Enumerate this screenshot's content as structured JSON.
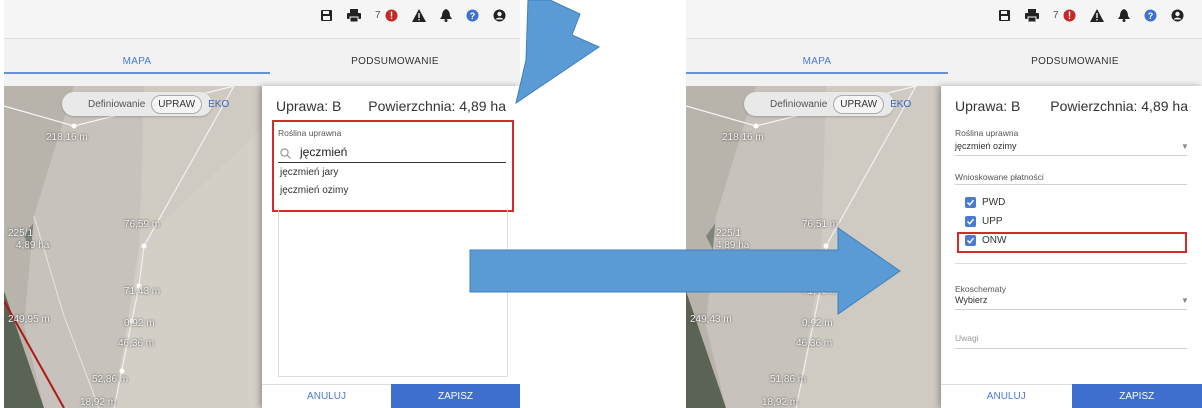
{
  "toolbar": {
    "notification_count": "7",
    "icons": [
      "save-icon",
      "print-icon",
      "error-badge-icon",
      "warning-icon",
      "bell-icon",
      "help-icon",
      "user-icon"
    ]
  },
  "tabs": {
    "map": "MAPA",
    "summary": "PODSUMOWANIE"
  },
  "map": {
    "mode_label": "Definiowanie",
    "mode_upraw": "UPRAW",
    "mode_eko": "EKO",
    "labels": [
      "218,16 m",
      "76,59 m",
      "225/1",
      "4,89 ha",
      "71,43 m",
      "249,95 m",
      "0,92 m",
      "46,36 m",
      "52,86 m",
      "18,92 m"
    ],
    "labels_right": [
      "218,16 m",
      "76,51 m",
      "225/1",
      "4,89 ha",
      "71,43 m",
      "249,43 m",
      "0,92 m",
      "46,36 m",
      "51,86 m",
      "18,92 m"
    ]
  },
  "left_dialog": {
    "title": "Uprawa: B",
    "area": "Powierzchnia: 4,89 ha",
    "crop_label": "Roślina uprawna",
    "search_value": "jęczmień",
    "options": [
      "jęczmień jary",
      "jęczmień ozimy"
    ],
    "cancel": "ANULUJ",
    "save": "ZAPISZ"
  },
  "right_dialog": {
    "title": "Uprawa: B",
    "area": "Powierzchnia: 4,89 ha",
    "crop_label": "Roślina uprawna",
    "crop_value": "jęczmień ozimy",
    "payments_label": "Wnioskowane płatności",
    "payments": [
      "PWD",
      "UPP",
      "ONW"
    ],
    "eco_label": "Ekoschematy",
    "eco_value": "Wybierz",
    "notes_label": "Uwagi",
    "cancel": "ANULUJ",
    "save": "ZAPISZ"
  },
  "colors": {
    "accent": "#3f6fcf",
    "highlight": "#d32a2a",
    "arrow": "#5b9bd5"
  }
}
